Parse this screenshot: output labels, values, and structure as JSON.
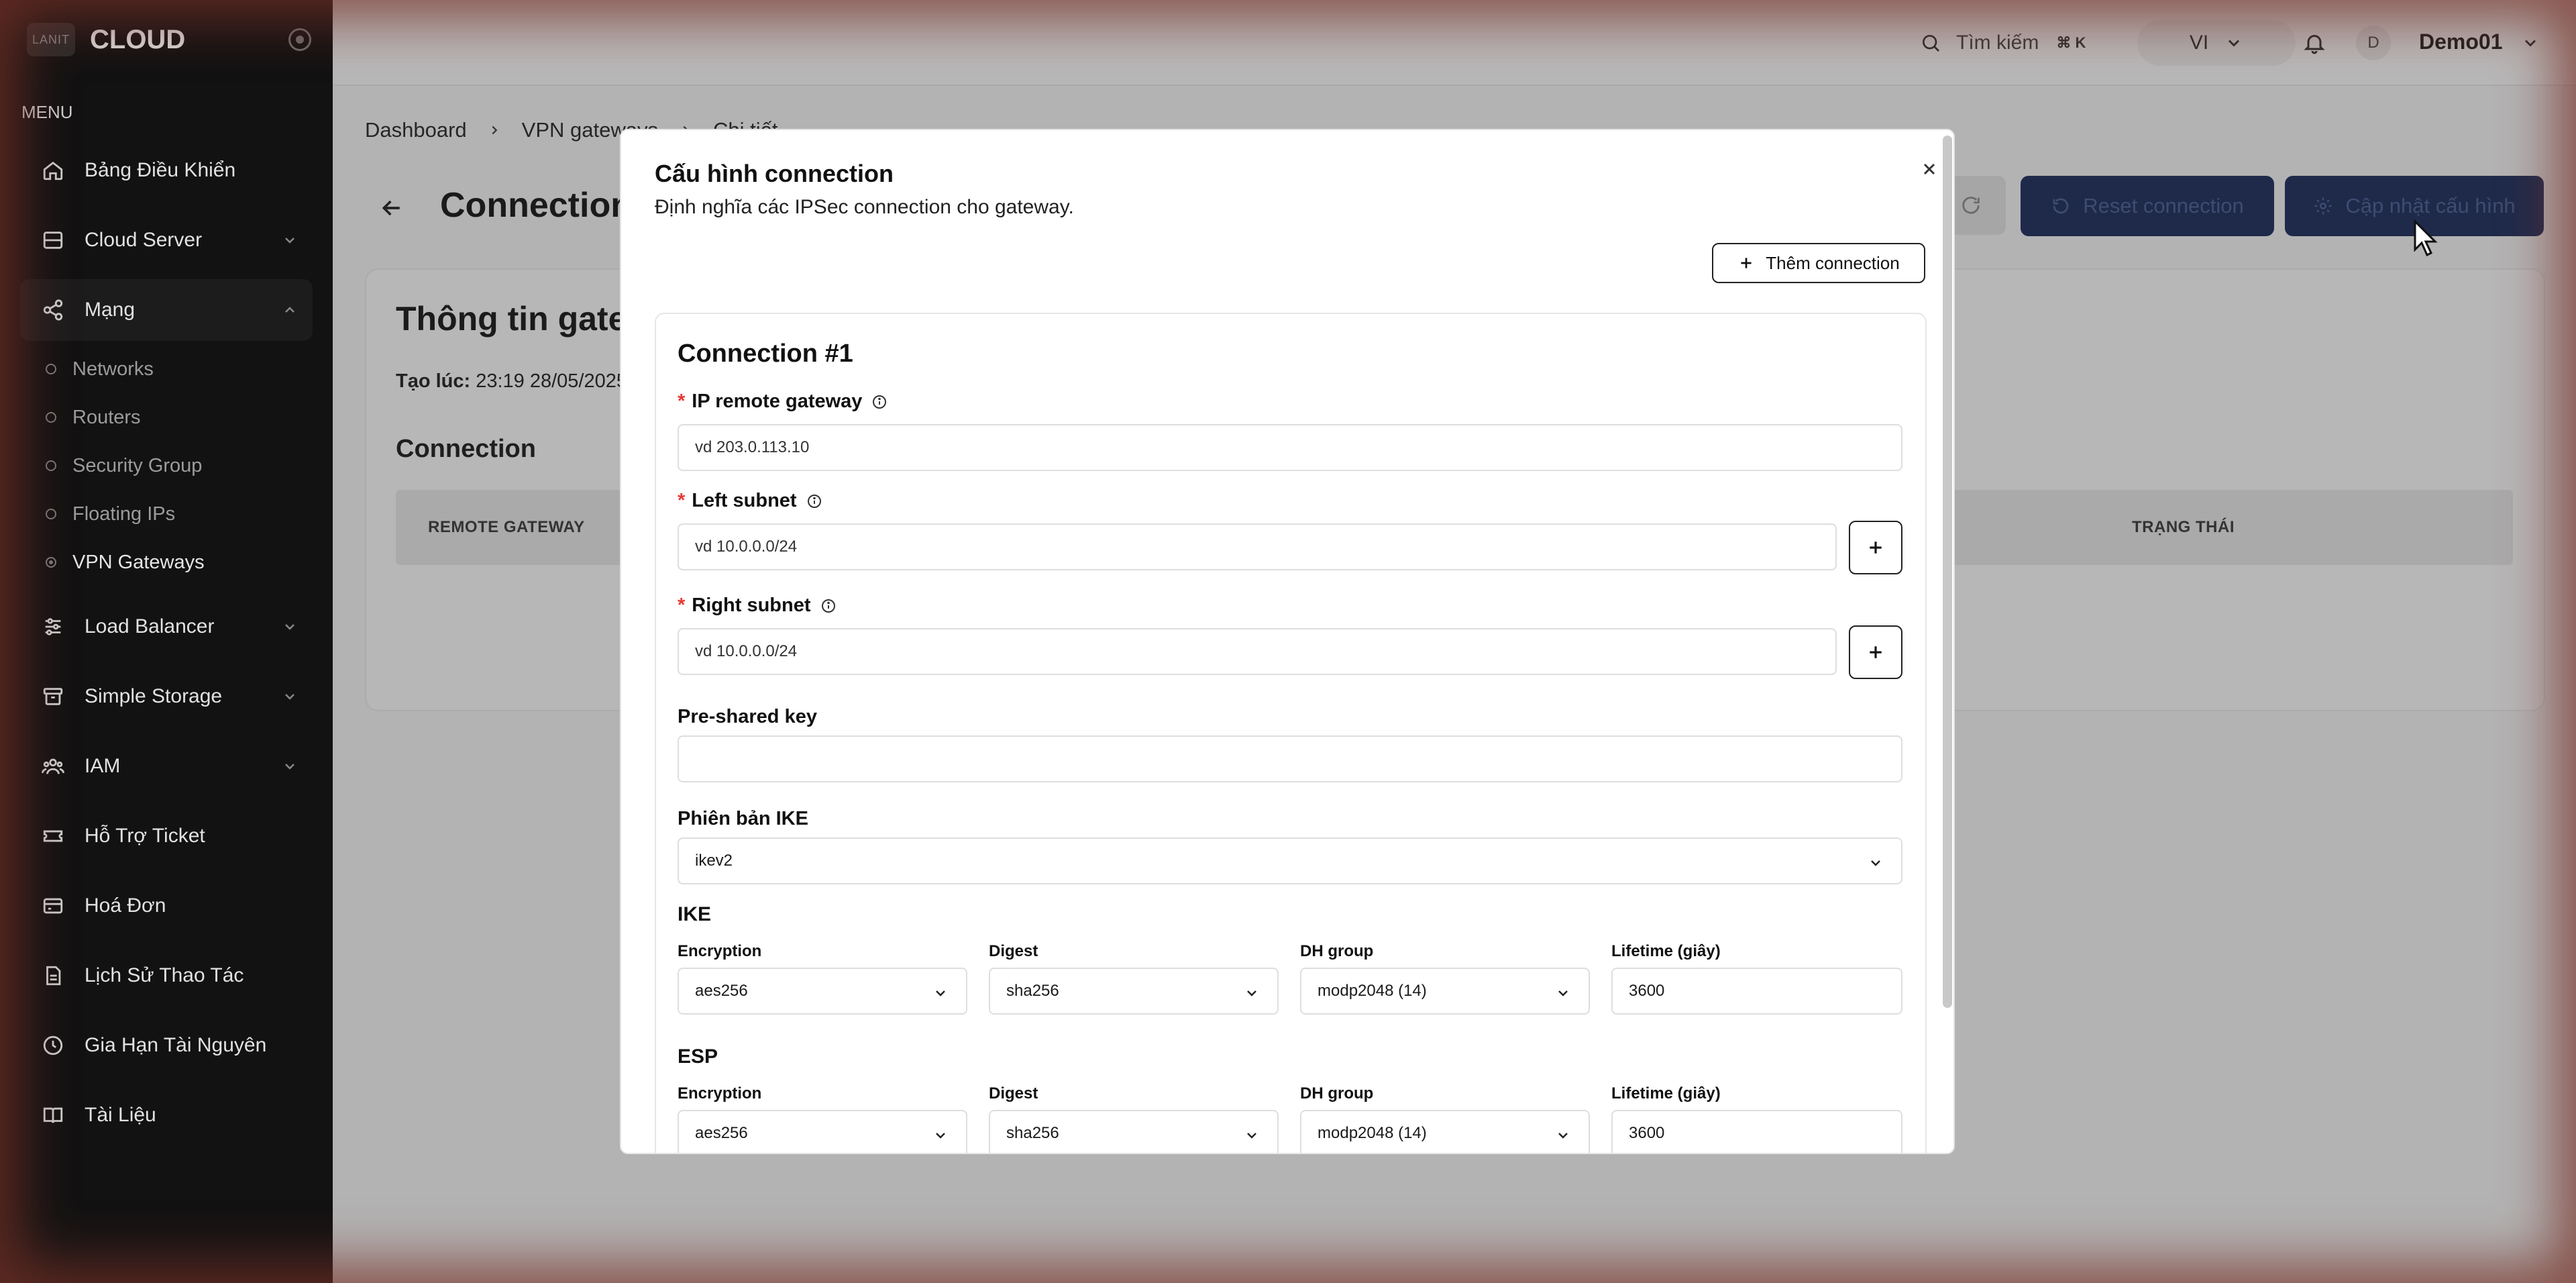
{
  "brand": {
    "logo_text": "LANIT",
    "name": "CLOUD"
  },
  "sidebar": {
    "menu_title": "MENU",
    "items": [
      {
        "label": "Bảng Điều Khiển",
        "icon": "home-icon"
      },
      {
        "label": "Cloud Server",
        "icon": "server-icon",
        "expandable": true
      },
      {
        "label": "Mạng",
        "icon": "share-network-icon",
        "expandable": true,
        "expanded": true
      },
      {
        "label": "Load Balancer",
        "icon": "sliders-icon",
        "expandable": true
      },
      {
        "label": "Simple Storage",
        "icon": "archive-icon",
        "expandable": true
      },
      {
        "label": "IAM",
        "icon": "users-icon",
        "expandable": true
      },
      {
        "label": "Hỗ Trợ Ticket",
        "icon": "ticket-icon"
      },
      {
        "label": "Hoá Đơn",
        "icon": "wallet-icon"
      },
      {
        "label": "Lịch Sử Thao Tác",
        "icon": "document-icon"
      },
      {
        "label": "Gia Hạn Tài Nguyên",
        "icon": "clock-icon"
      },
      {
        "label": "Tài Liệu",
        "icon": "book-icon"
      }
    ],
    "network_sub": [
      {
        "label": "Networks"
      },
      {
        "label": "Routers"
      },
      {
        "label": "Security Group"
      },
      {
        "label": "Floating IPs"
      },
      {
        "label": "VPN Gateways",
        "active": true
      }
    ]
  },
  "topbar": {
    "search_label": "Tìm kiếm",
    "search_shortcut": "⌘ K",
    "language": "VI",
    "avatar_initial": "D",
    "username": "Demo01"
  },
  "breadcrumb": [
    "Dashboard",
    "VPN gateways",
    "Chi tiết"
  ],
  "page": {
    "title": "Connection",
    "reset_label": "Reset connection",
    "update_label": "Cập nhật cấu hình"
  },
  "card": {
    "title": "Thông tin gateway",
    "created_label": "Tạo lúc:",
    "created_value": "23:19 28/05/2025",
    "section_title": "Connection",
    "columns": [
      "REMOTE GATEWAY",
      "TRẠNG THÁI"
    ]
  },
  "modal": {
    "title": "Cấu hình connection",
    "description": "Định nghĩa các IPSec connection cho gateway.",
    "add_label": "Thêm connection",
    "connection_title": "Connection #1",
    "ip_remote_label": "IP remote gateway",
    "ip_remote_placeholder": "vd 203.0.113.10",
    "left_subnet_label": "Left subnet",
    "left_subnet_placeholder": "vd 10.0.0.0/24",
    "right_subnet_label": "Right subnet",
    "right_subnet_placeholder": "vd 10.0.0.0/24",
    "psk_label": "Pre-shared key",
    "psk_value": "",
    "ike_version_label": "Phiên bản IKE",
    "ike_version_value": "ikev2",
    "ike": {
      "title": "IKE",
      "encryption_label": "Encryption",
      "encryption": "aes256",
      "digest_label": "Digest",
      "digest": "sha256",
      "dh_label": "DH group",
      "dh": "modp2048 (14)",
      "lifetime_label": "Lifetime (giây)",
      "lifetime": "3600"
    },
    "esp": {
      "title": "ESP",
      "encryption_label": "Encryption",
      "encryption": "aes256",
      "digest_label": "Digest",
      "digest": "sha256",
      "dh_label": "DH group",
      "dh": "modp2048 (14)",
      "lifetime_label": "Lifetime (giây)",
      "lifetime": "3600"
    }
  },
  "colors": {
    "sidebar_bg": "#121212",
    "overlay_bg": "#b3b3b3",
    "primary_dim": "#1f2a4a",
    "required": "#e53935"
  }
}
